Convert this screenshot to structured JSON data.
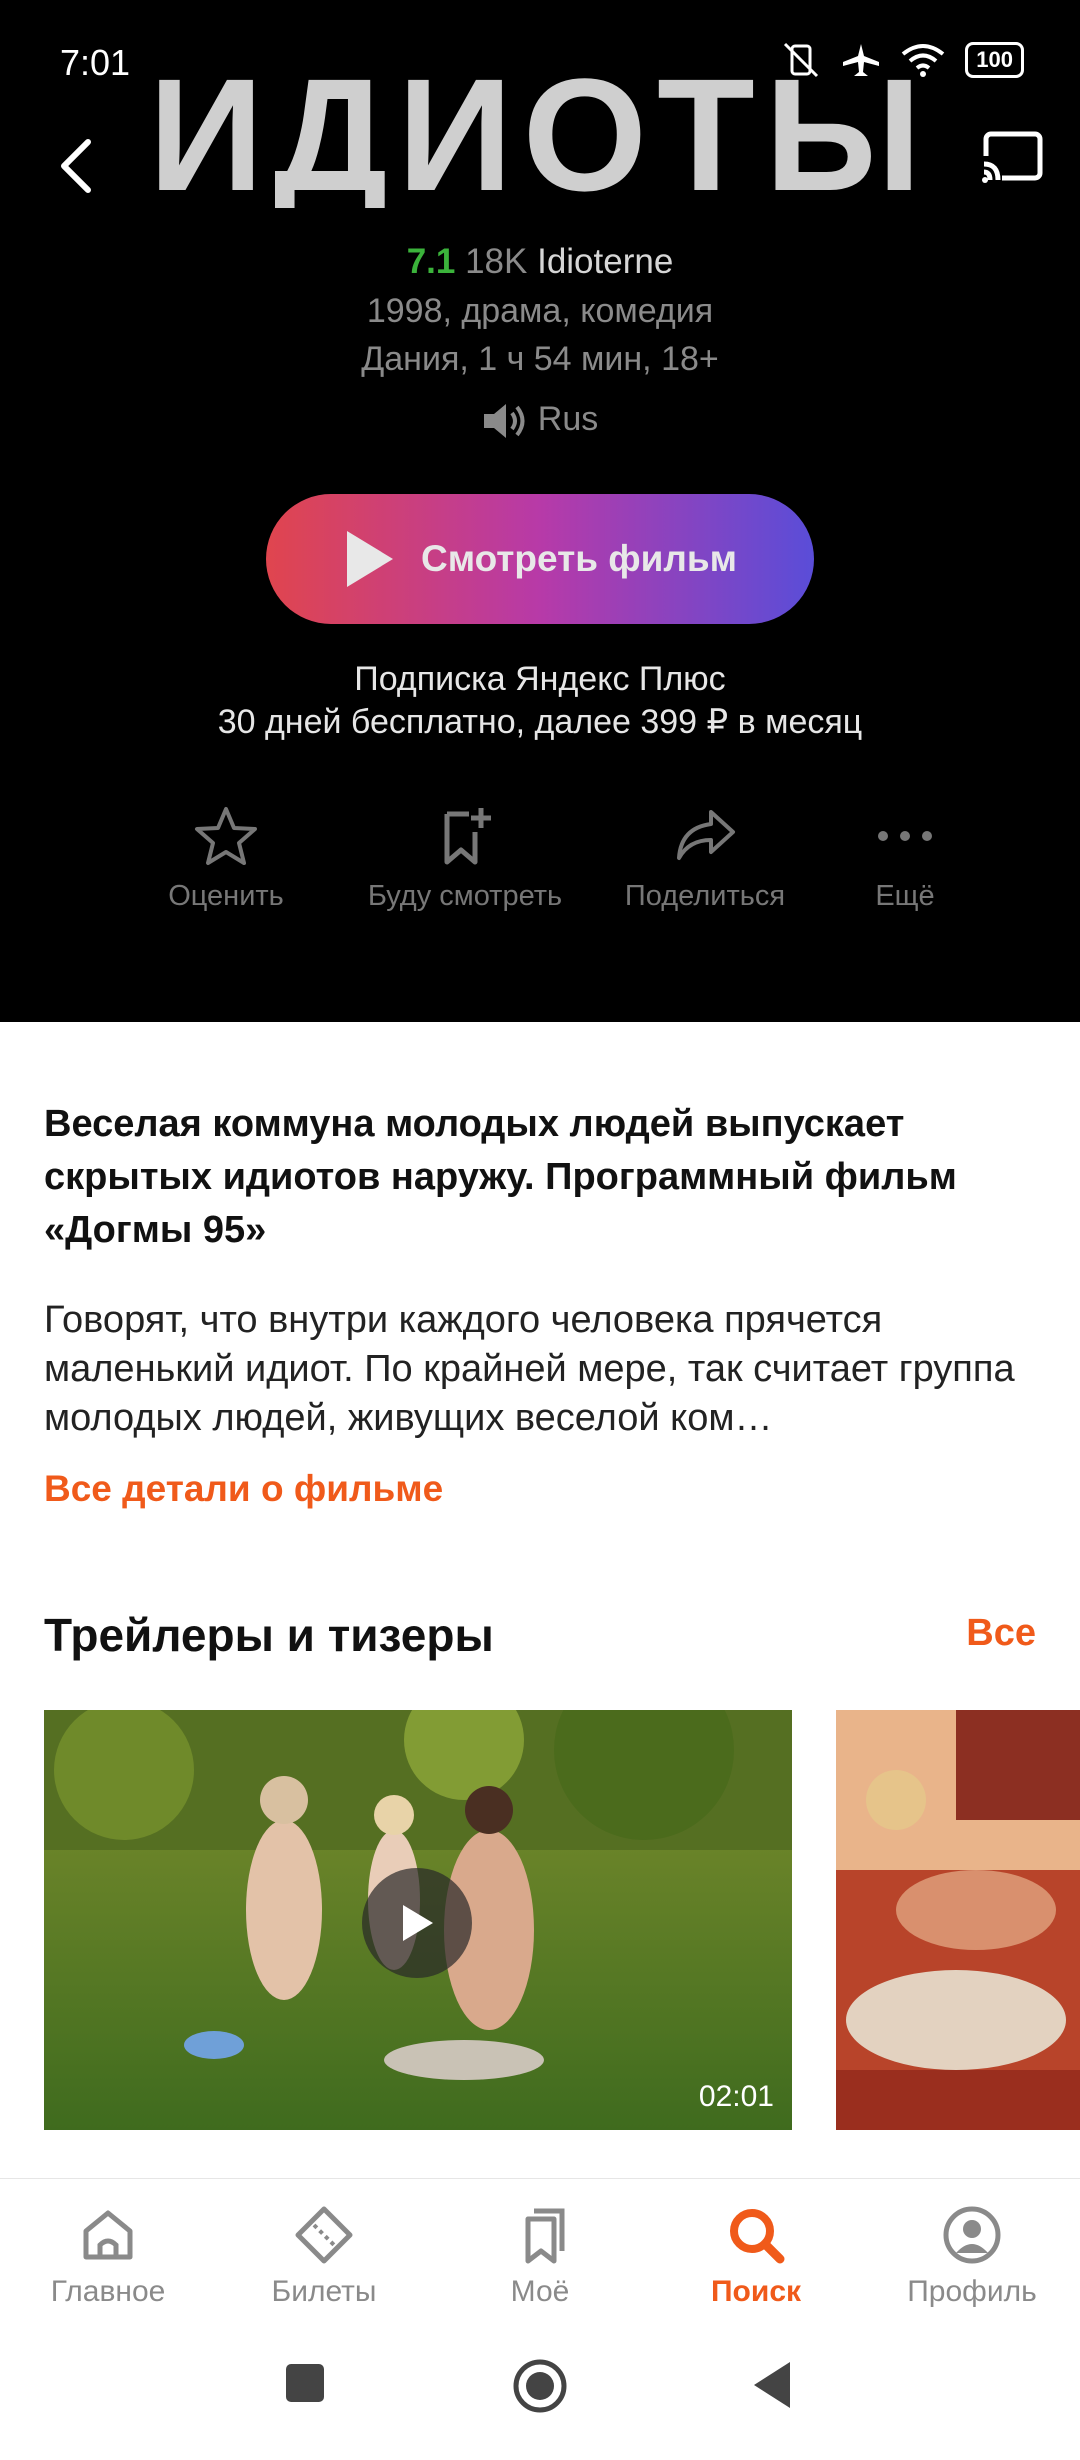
{
  "status_bar": {
    "time": "7:01",
    "battery": "100"
  },
  "logo": {
    "text": "ИДИОТЫ"
  },
  "movie": {
    "rating": "7.1",
    "votes": "18K",
    "original_title": "Idioterne",
    "year_genres": "1998, драма, комедия",
    "country_duration_age": "Дания, 1 ч 54 мин, 18+",
    "audio": "Rus"
  },
  "watch_button": {
    "label": "Смотреть фильм"
  },
  "subscription": {
    "line1": "Подписка Яндекс Плюс",
    "line2": "30 дней бесплатно, далее 399 ₽ в месяц"
  },
  "actions": [
    {
      "label": "Оценить",
      "icon": "star-icon"
    },
    {
      "label": "Буду смотреть",
      "icon": "bookmark-add-icon"
    },
    {
      "label": "Поделиться",
      "icon": "share-icon"
    },
    {
      "label": "Ещё",
      "icon": "more-icon"
    }
  ],
  "tagline": "Веселая коммуна молодых людей выпускает скрытых идиотов наружу. Программный фильм «Догмы 95»",
  "description": "Говорят, что внутри каждого человека прячется маленький идиот. По крайней мере, так считает группа молодых людей, живущих веселой ком…",
  "details_link": "Все детали о фильме",
  "trailers": {
    "title": "Трейлеры и тизеры",
    "all_label": "Все",
    "items": [
      {
        "duration": "02:01"
      }
    ]
  },
  "tabbar": [
    {
      "label": "Главное",
      "icon": "home-icon"
    },
    {
      "label": "Билеты",
      "icon": "ticket-icon"
    },
    {
      "label": "Моё",
      "icon": "my-bookmarks-icon"
    },
    {
      "label": "Поиск",
      "icon": "search-icon",
      "active": true
    },
    {
      "label": "Профиль",
      "icon": "profile-icon"
    }
  ],
  "colors": {
    "accent": "#f05a1a",
    "rating": "#3bb33b",
    "hero_bg": "#000000"
  }
}
